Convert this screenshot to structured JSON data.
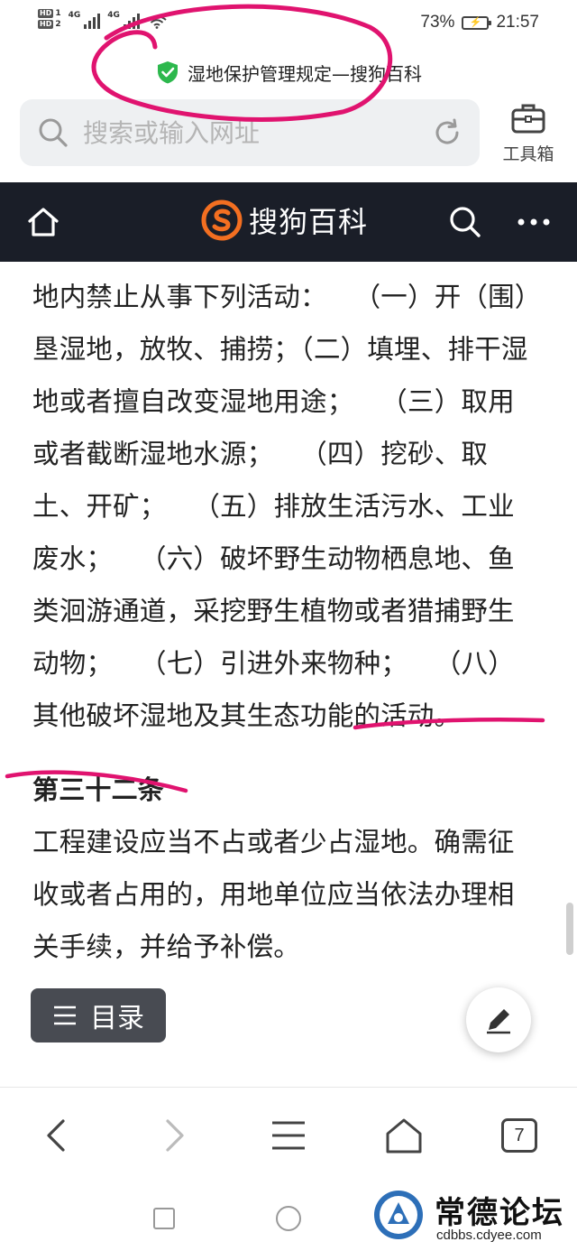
{
  "status_bar": {
    "sim1": "HD",
    "sim2": "HD",
    "sim1_num": "1",
    "sim2_num": "2",
    "network1": "4G",
    "network2": "4G",
    "battery": "73%",
    "time": "21:57"
  },
  "page": {
    "title": "湿地保护管理规定—搜狗百科"
  },
  "address_bar": {
    "placeholder": "搜索或输入网址"
  },
  "toolbox": {
    "label": "工具箱"
  },
  "site": {
    "logo_text": "搜狗百科"
  },
  "article": {
    "paragraph1": "地内禁止从事下列活动：　　（一）开（围）垦湿地，放牧、捕捞；（二）填埋、排干湿地或者擅自改变湿地用途；　　（三）取用或者截断湿地水源；　　（四）挖砂、取土、开矿；　　（五）排放生活污水、工业废水；　　（六）破坏野生动物栖息地、鱼类洄游通道，采挖野生植物或者猎捕野生动物；　　（七）引进外来物种；　　（八）其他破坏湿地及其生态功能的活动。",
    "section_title": "第三十二条",
    "paragraph2": "工程建设应当不占或者少占湿地。确需征收或者占用的，用地单位应当依法办理相关手续，并给予补偿。"
  },
  "floating": {
    "toc_label": "目录"
  },
  "bottom_nav": {
    "tab_count": "7"
  },
  "watermark": {
    "title": "常德论坛",
    "url": "cdbbs.cdyee.com",
    "seal_text": "常德论坛"
  },
  "colors": {
    "header_bg": "#1a1e28",
    "logo_orange": "#f36f21",
    "shield_green": "#2db84d",
    "annotation_magenta": "#e0136f"
  }
}
